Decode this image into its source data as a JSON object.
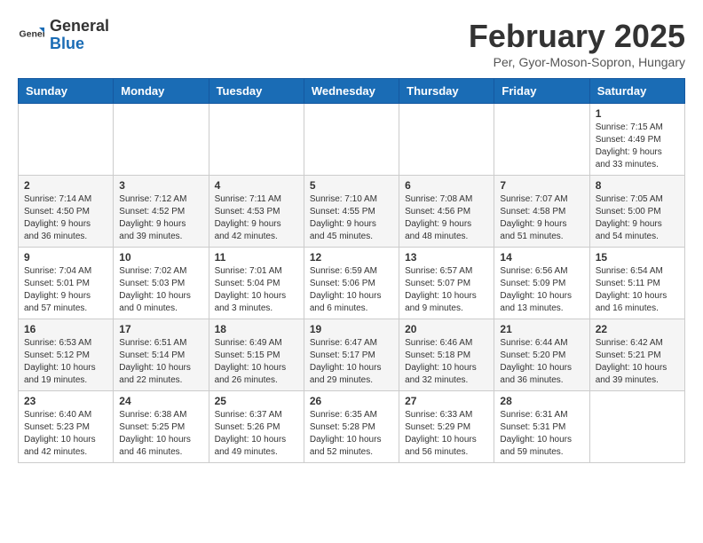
{
  "header": {
    "logo_general": "General",
    "logo_blue": "Blue",
    "month_title": "February 2025",
    "location": "Per, Gyor-Moson-Sopron, Hungary"
  },
  "days_of_week": [
    "Sunday",
    "Monday",
    "Tuesday",
    "Wednesday",
    "Thursday",
    "Friday",
    "Saturday"
  ],
  "weeks": [
    [
      {
        "day": "",
        "info": ""
      },
      {
        "day": "",
        "info": ""
      },
      {
        "day": "",
        "info": ""
      },
      {
        "day": "",
        "info": ""
      },
      {
        "day": "",
        "info": ""
      },
      {
        "day": "",
        "info": ""
      },
      {
        "day": "1",
        "info": "Sunrise: 7:15 AM\nSunset: 4:49 PM\nDaylight: 9 hours and 33 minutes."
      }
    ],
    [
      {
        "day": "2",
        "info": "Sunrise: 7:14 AM\nSunset: 4:50 PM\nDaylight: 9 hours and 36 minutes."
      },
      {
        "day": "3",
        "info": "Sunrise: 7:12 AM\nSunset: 4:52 PM\nDaylight: 9 hours and 39 minutes."
      },
      {
        "day": "4",
        "info": "Sunrise: 7:11 AM\nSunset: 4:53 PM\nDaylight: 9 hours and 42 minutes."
      },
      {
        "day": "5",
        "info": "Sunrise: 7:10 AM\nSunset: 4:55 PM\nDaylight: 9 hours and 45 minutes."
      },
      {
        "day": "6",
        "info": "Sunrise: 7:08 AM\nSunset: 4:56 PM\nDaylight: 9 hours and 48 minutes."
      },
      {
        "day": "7",
        "info": "Sunrise: 7:07 AM\nSunset: 4:58 PM\nDaylight: 9 hours and 51 minutes."
      },
      {
        "day": "8",
        "info": "Sunrise: 7:05 AM\nSunset: 5:00 PM\nDaylight: 9 hours and 54 minutes."
      }
    ],
    [
      {
        "day": "9",
        "info": "Sunrise: 7:04 AM\nSunset: 5:01 PM\nDaylight: 9 hours and 57 minutes."
      },
      {
        "day": "10",
        "info": "Sunrise: 7:02 AM\nSunset: 5:03 PM\nDaylight: 10 hours and 0 minutes."
      },
      {
        "day": "11",
        "info": "Sunrise: 7:01 AM\nSunset: 5:04 PM\nDaylight: 10 hours and 3 minutes."
      },
      {
        "day": "12",
        "info": "Sunrise: 6:59 AM\nSunset: 5:06 PM\nDaylight: 10 hours and 6 minutes."
      },
      {
        "day": "13",
        "info": "Sunrise: 6:57 AM\nSunset: 5:07 PM\nDaylight: 10 hours and 9 minutes."
      },
      {
        "day": "14",
        "info": "Sunrise: 6:56 AM\nSunset: 5:09 PM\nDaylight: 10 hours and 13 minutes."
      },
      {
        "day": "15",
        "info": "Sunrise: 6:54 AM\nSunset: 5:11 PM\nDaylight: 10 hours and 16 minutes."
      }
    ],
    [
      {
        "day": "16",
        "info": "Sunrise: 6:53 AM\nSunset: 5:12 PM\nDaylight: 10 hours and 19 minutes."
      },
      {
        "day": "17",
        "info": "Sunrise: 6:51 AM\nSunset: 5:14 PM\nDaylight: 10 hours and 22 minutes."
      },
      {
        "day": "18",
        "info": "Sunrise: 6:49 AM\nSunset: 5:15 PM\nDaylight: 10 hours and 26 minutes."
      },
      {
        "day": "19",
        "info": "Sunrise: 6:47 AM\nSunset: 5:17 PM\nDaylight: 10 hours and 29 minutes."
      },
      {
        "day": "20",
        "info": "Sunrise: 6:46 AM\nSunset: 5:18 PM\nDaylight: 10 hours and 32 minutes."
      },
      {
        "day": "21",
        "info": "Sunrise: 6:44 AM\nSunset: 5:20 PM\nDaylight: 10 hours and 36 minutes."
      },
      {
        "day": "22",
        "info": "Sunrise: 6:42 AM\nSunset: 5:21 PM\nDaylight: 10 hours and 39 minutes."
      }
    ],
    [
      {
        "day": "23",
        "info": "Sunrise: 6:40 AM\nSunset: 5:23 PM\nDaylight: 10 hours and 42 minutes."
      },
      {
        "day": "24",
        "info": "Sunrise: 6:38 AM\nSunset: 5:25 PM\nDaylight: 10 hours and 46 minutes."
      },
      {
        "day": "25",
        "info": "Sunrise: 6:37 AM\nSunset: 5:26 PM\nDaylight: 10 hours and 49 minutes."
      },
      {
        "day": "26",
        "info": "Sunrise: 6:35 AM\nSunset: 5:28 PM\nDaylight: 10 hours and 52 minutes."
      },
      {
        "day": "27",
        "info": "Sunrise: 6:33 AM\nSunset: 5:29 PM\nDaylight: 10 hours and 56 minutes."
      },
      {
        "day": "28",
        "info": "Sunrise: 6:31 AM\nSunset: 5:31 PM\nDaylight: 10 hours and 59 minutes."
      },
      {
        "day": "",
        "info": ""
      }
    ]
  ]
}
